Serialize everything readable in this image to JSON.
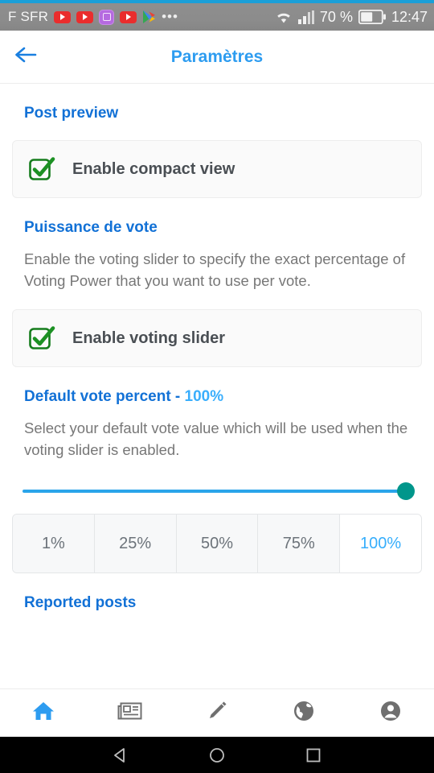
{
  "statusbar": {
    "carrier": "F SFR",
    "app_icons": [
      "youtube-icon",
      "youtube-icon",
      "gallery-icon",
      "youtube-icon",
      "play-store-icon"
    ],
    "overflow": "•••",
    "wifi_icon": "wifi-icon",
    "signal_icon": "signal-bars-icon",
    "battery_percent": "70 %",
    "battery_icon": "battery-icon",
    "clock": "12:47"
  },
  "appbar": {
    "back_icon": "back-arrow-icon",
    "title": "Paramètres"
  },
  "sections": {
    "post_preview": {
      "title": "Post preview",
      "option_label": "Enable compact view",
      "checked": true
    },
    "voting_power": {
      "title": "Puissance de vote",
      "description": "Enable the voting slider to specify the exact percentage of Voting Power that you want to use per vote.",
      "option_label": "Enable voting slider",
      "checked": true
    },
    "default_vote_percent": {
      "title_prefix": "Default vote percent - ",
      "value": "100%",
      "description": "Select your default vote value which will be used when the voting slider is enabled.",
      "slider_value": 100,
      "slider_min": 1,
      "slider_max": 100,
      "presets": [
        {
          "label": "1%",
          "selected": false
        },
        {
          "label": "25%",
          "selected": false
        },
        {
          "label": "50%",
          "selected": false
        },
        {
          "label": "75%",
          "selected": false
        },
        {
          "label": "100%",
          "selected": true
        }
      ]
    },
    "reported_posts": {
      "title": "Reported posts"
    }
  },
  "bottomnav": {
    "items": [
      {
        "name": "home-icon",
        "active": true
      },
      {
        "name": "news-icon",
        "active": false
      },
      {
        "name": "pencil-icon",
        "active": false
      },
      {
        "name": "globe-icon",
        "active": false
      },
      {
        "name": "account-icon",
        "active": false
      }
    ]
  },
  "androidnav": {
    "back": "back-triangle-icon",
    "home": "home-circle-icon",
    "recents": "recents-square-icon"
  },
  "colors": {
    "accent_blue": "#2d9cf0",
    "title_blue": "#1271d6",
    "light_blue": "#3aaefc",
    "check_green": "#157c1c",
    "slider_track": "#2aa4ea",
    "slider_thumb": "#00968b"
  }
}
